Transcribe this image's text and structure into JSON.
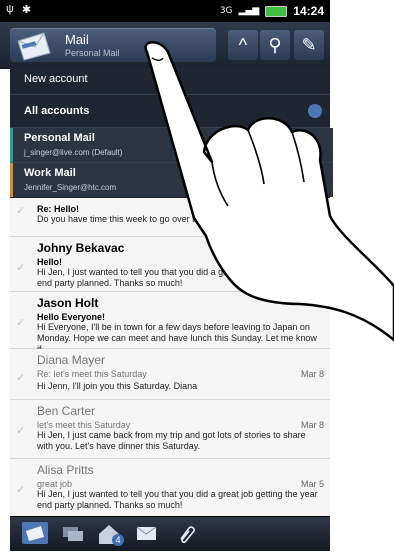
{
  "status_bar": {
    "network": "3G",
    "time": "14:24"
  },
  "header": {
    "title": "Mail",
    "subtitle": "Personal Mail"
  },
  "dropdown": {
    "new_account": "New account",
    "all_accounts": "All accounts",
    "accounts": [
      {
        "name": "Personal Mail",
        "email": "j_singer@live.com (Default)",
        "color": "#27a0a0"
      },
      {
        "name": "Work Mail",
        "email": "Jennifer_Singer@htc.com",
        "color": "#e08a2a"
      }
    ]
  },
  "mails": [
    {
      "sender": "",
      "subject": "Re: Hello!",
      "preview": "Do you have time this week to go over the plan with our designer?",
      "date": ""
    },
    {
      "sender": "Johny Bekavac",
      "subject": "Hello!",
      "preview": "Hi Jen, I just wanted to tell you that you did a great job getting the year end party planned. Thanks so much!",
      "date": ""
    },
    {
      "sender": "Jason Holt",
      "subject": "Hello Everyone!",
      "preview": "Hi Everyone, I'll be in town for a few days before leaving to Japan on Monday. Hope we can meet and have lunch this Sunday. Let me know if",
      "date": ""
    },
    {
      "sender": "Diana Mayer",
      "subject": "Re: let's meet this Saturday",
      "preview": "Hi Jenn,  I'll join you this Saturday.  Diana",
      "date": "Mar 8"
    },
    {
      "sender": "Ben Carter",
      "subject": "let's meet this Saturday",
      "preview": "Hi Jen, I just came back from my trip and got lots of stories to share with you. Let's have dinner this Saturday.",
      "date": "Mar 8"
    },
    {
      "sender": "Alisa Pritts",
      "subject": "great job",
      "preview": "Hi Jen, I just wanted to tell you that you did a great job getting the year end party planned. Thanks so much!",
      "date": "Mar 5"
    }
  ],
  "tabs": [
    {
      "icon": "inbox-icon"
    },
    {
      "icon": "conversations-icon"
    },
    {
      "icon": "group-mail-icon",
      "badge": "4"
    },
    {
      "icon": "unread-icon"
    },
    {
      "icon": "attachment-icon"
    }
  ]
}
